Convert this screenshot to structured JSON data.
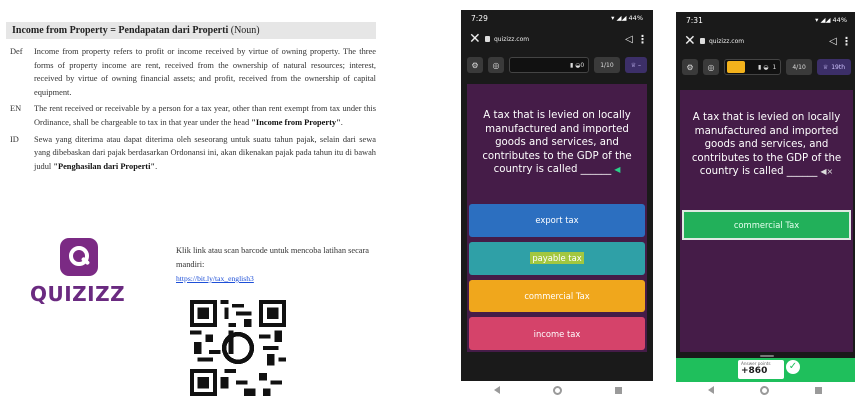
{
  "document": {
    "title": "Income from Property",
    "title_eq": " = Pendapatan dari Properti ",
    "title_pos": "(Noun)",
    "entries": [
      {
        "tag": "Def",
        "text": "Income from property refers to profit or income received by virtue of owning property. The three forms of property income are rent, received from the ownership of natural resources; interest, received by virtue of owning financial assets; and profit, received from the ownership of capital equipment."
      },
      {
        "tag": "EN",
        "text_before": "The rent received or receivable by a person for a tax year, other than rent exempt from tax under this Ordinance, shall be chargeable to tax in that year under the head ",
        "bold": "\"Income from Property\"",
        "text_after": "."
      },
      {
        "tag": "ID",
        "text_before": "Sewa yang diterima atau dapat diterima oleh seseorang untuk suatu tahun pajak, selain dari sewa yang dibebaskan dari pajak berdasarkan Ordonansi ini, akan dikenakan pajak pada tahun itu di bawah judul ",
        "bold": "\"Penghasilan dari Properti\"",
        "text_after": "."
      }
    ],
    "logo_text": "QUIZIZZ",
    "scan_text": "Klik link atau scan barcode untuk mencoba latihan secara mandiri:",
    "scan_link": "https://bit.ly/tax_english3"
  },
  "phone1": {
    "time": "7:29",
    "battery": "44%",
    "url": "quizizz.com",
    "count": "1/10",
    "question": "A tax that is levied on locally manufactured and imported goods and services, and contributes to the GDP of the country is called ______",
    "options": [
      {
        "label": "export tax",
        "color": "#2c6fc0"
      },
      {
        "label": "payable tax",
        "color": "#2fa0a7"
      },
      {
        "label": "commercial Tax",
        "color": "#f0a71c"
      },
      {
        "label": "income tax",
        "color": "#d5436a"
      }
    ]
  },
  "phone2": {
    "time": "7:31",
    "battery": "44%",
    "url": "quizizz.com",
    "streak": "1",
    "count": "4/10",
    "rank": "19th",
    "question": "A tax that is levied on locally manufactured and imported goods and services, and contributes to the GDP of the country is called ______",
    "correct_answer": "commercial Tax",
    "score_label": "Answer points",
    "score_points": "+860"
  },
  "colors": {
    "question_bg": "#451c48",
    "correct_green": "#22b05a",
    "brand_purple": "#7b2a84"
  }
}
